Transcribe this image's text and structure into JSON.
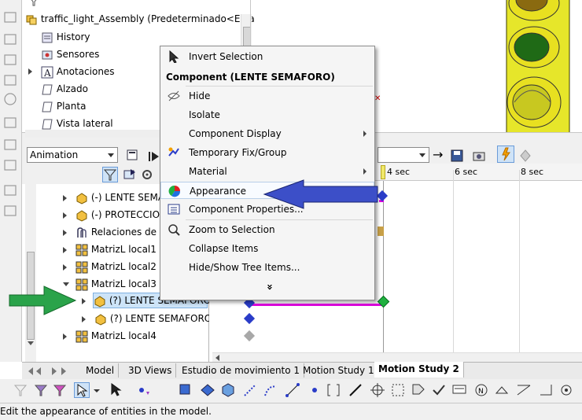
{
  "tree_top": {
    "root": "traffic_light_Assembly  (Predeterminado<Estado",
    "items": [
      "History",
      "Sensores",
      "Anotaciones",
      "Alzado",
      "Planta",
      "Vista lateral"
    ]
  },
  "animation": {
    "mode": "Animation",
    "tree": [
      "(-) LENTE SEMA",
      "(-) PROTECCION",
      "Relaciones de po",
      "MatrizL local1",
      "MatrizL local2",
      "MatrizL local3",
      "(?) LENTE SEMAFORO<",
      "(?) LENTE SEMAFORO<",
      "MatrizL local4"
    ]
  },
  "timeline": {
    "ticks": [
      "4 sec",
      "6 sec",
      "8 sec"
    ]
  },
  "context_menu": {
    "invert": "Invert Selection",
    "header": "Component (LENTE SEMAFORO)",
    "items": [
      "Hide",
      "Isolate",
      "Component Display",
      "Temporary Fix/Group",
      "Material",
      "Appearance",
      "Component Properties...",
      "Zoom to Selection",
      "Collapse Items",
      "Hide/Show Tree Items..."
    ],
    "more": "»"
  },
  "tabs": [
    "Model",
    "3D Views",
    "Estudio de movimiento 1",
    "Motion Study 1",
    "Motion Study 2"
  ],
  "status": "Edit the appearance of entities in the model.",
  "colors": {
    "highlight_arrow": "#3c4fc8",
    "green_arrow": "#2aa34a",
    "magenta": "#e000e0",
    "yellow": "#e8e800"
  }
}
